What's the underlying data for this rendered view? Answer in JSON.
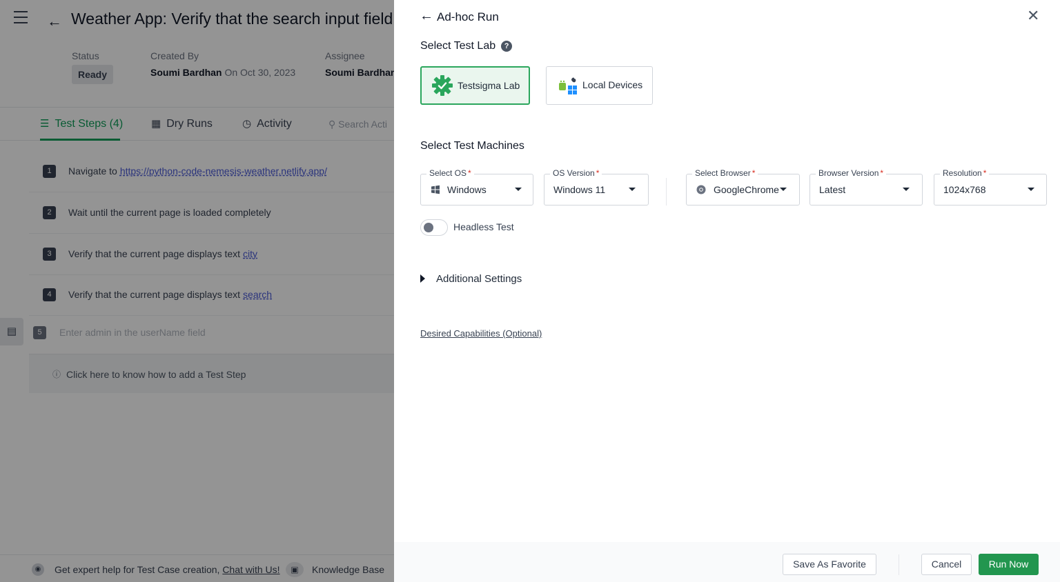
{
  "background": {
    "title": "Weather App: Verify that the search input field is",
    "meta": {
      "status_label": "Status",
      "status_value": "Ready",
      "created_label": "Created By",
      "created_by": "Soumi Bardhan",
      "created_on": "On Oct 30, 2023",
      "assignee_label": "Assignee",
      "assignee": "Soumi Bardhan"
    },
    "tabs": [
      {
        "label": "Test Steps (4)",
        "icon": "list-icon"
      },
      {
        "label": "Dry Runs",
        "icon": "calendar-icon"
      },
      {
        "label": "Activity",
        "icon": "clock-icon"
      }
    ],
    "search_placeholder": "Search Acti",
    "steps": [
      {
        "num": "1",
        "text": "Navigate to",
        "link": "https://python-code-nemesis-weather.netlify.app/"
      },
      {
        "num": "2",
        "text": "Wait until the current page is loaded completely",
        "link": ""
      },
      {
        "num": "3",
        "text": "Verify that the current page displays text",
        "link": "city"
      },
      {
        "num": "4",
        "text": "Verify that the current page displays text",
        "link": "search"
      }
    ],
    "step5_num": "5",
    "step5_placeholder": "Enter admin in the userName field",
    "help_text": "Click here to know how to add a Test Step",
    "footer": {
      "expert_text": "Get expert help for Test Case creation,",
      "chat_link": "Chat with Us!",
      "kb_label": "Knowledge Base"
    }
  },
  "drawer": {
    "title": "Ad-hoc Run",
    "select_lab_title": "Select Test Lab",
    "labs": [
      {
        "label": "Testsigma Lab",
        "selected": true,
        "icon": "testsigma-gear-icon"
      },
      {
        "label": "Local Devices",
        "selected": false,
        "icon": "local-devices-icon"
      }
    ],
    "machines_title": "Select Test Machines",
    "fields": {
      "os": {
        "label": "Select OS",
        "value": "Windows",
        "icon": "windows-icon"
      },
      "os_version": {
        "label": "OS Version",
        "value": "Windows 11"
      },
      "browser": {
        "label": "Select Browser",
        "value": "GoogleChrome",
        "icon": "chrome-icon"
      },
      "browser_version": {
        "label": "Browser Version",
        "value": "Latest"
      },
      "resolution": {
        "label": "Resolution",
        "value": "1024x768"
      }
    },
    "required_mark": "*",
    "headless_label": "Headless Test",
    "headless_on": false,
    "additional_settings": "Additional Settings",
    "capabilities_link": "Desired Capabilities (Optional)",
    "buttons": {
      "save_favorite": "Save As Favorite",
      "cancel": "Cancel",
      "run_now": "Run Now"
    }
  },
  "colors": {
    "accent_green": "#22964f",
    "selected_card_bg": "#eaf6ee",
    "required_red": "#d92d20",
    "link_blue": "#4b5bd6"
  }
}
